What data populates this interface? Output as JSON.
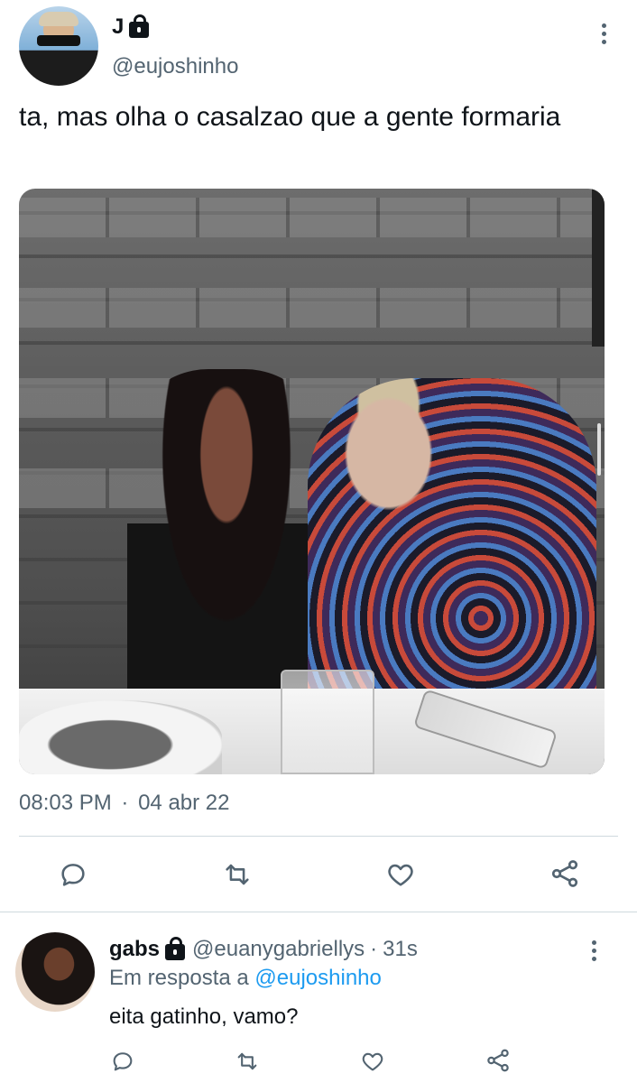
{
  "tweet": {
    "author_name": "J",
    "author_handle": "@eujoshinho",
    "text": "ta, mas olha o casalzao que a gente formaria",
    "time": "08:03 PM",
    "date": "04 abr 22",
    "separator": "·",
    "icons": {
      "more": "more-vertical-icon",
      "lock": "lock-icon",
      "reply": "reply-icon",
      "retweet": "retweet-icon",
      "like": "like-icon",
      "share": "share-icon"
    }
  },
  "reply": {
    "author_name": "gabs",
    "author_handle": "@euanygabriellys",
    "separator": "·",
    "time_ago": "31s",
    "in_reply_prefix": "Em resposta a",
    "in_reply_handle": "@eujoshinho",
    "text": "eita gatinho, vamo?"
  },
  "colors": {
    "text": "#0f1419",
    "secondary": "#536471",
    "link": "#1d9bf0",
    "divider": "#cfd9de"
  }
}
